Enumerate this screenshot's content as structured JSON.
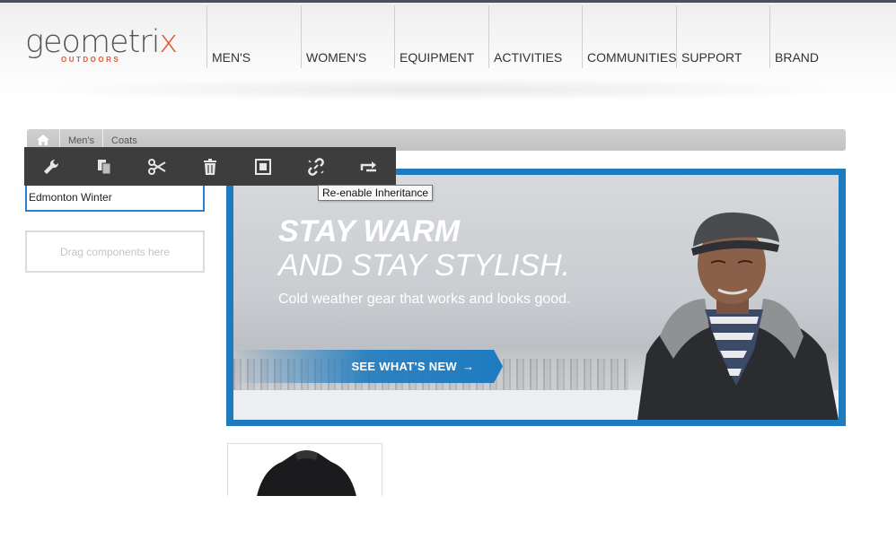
{
  "logo": {
    "main_prefix": "geometri",
    "main_x": "x",
    "sub": "OUTDOORS"
  },
  "nav": [
    {
      "label": "MEN'S"
    },
    {
      "label": "WOMEN'S"
    },
    {
      "label": "EQUIPMENT"
    },
    {
      "label": "ACTIVITIES"
    },
    {
      "label": "COMMUNITIES"
    },
    {
      "label": "SUPPORT"
    },
    {
      "label": "BRAND"
    }
  ],
  "breadcrumb": {
    "items": [
      "Men's",
      "Coats"
    ]
  },
  "toolbar": {
    "buttons": [
      "wrench-icon",
      "copy-icon",
      "cut-icon",
      "delete-icon",
      "group-icon",
      "link-icon",
      "move-icon"
    ],
    "tooltip": "Re-enable Inheritance"
  },
  "component": {
    "title": "Edmonton Winter",
    "drop_zone": "Drag components here"
  },
  "hero": {
    "headline_1": "STAY WARM",
    "headline_2": "AND STAY STYLISH.",
    "tagline": "Cold weather gear that works and looks good.",
    "cta": "SEE WHAT'S NEW",
    "accent": "#1e7bc0"
  }
}
